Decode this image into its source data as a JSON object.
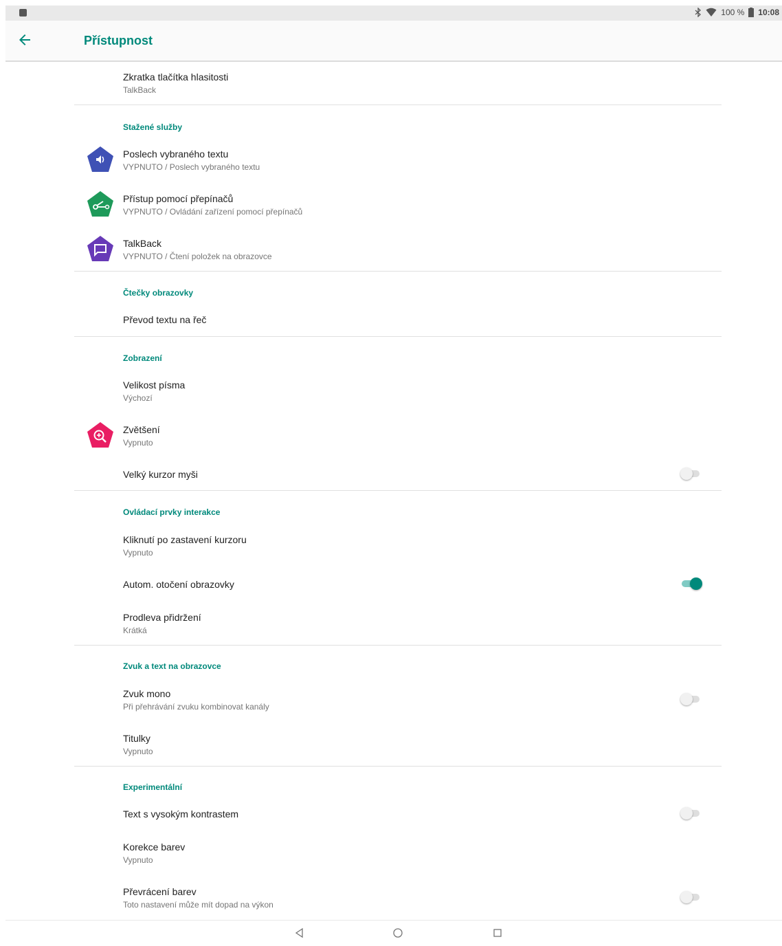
{
  "status_bar": {
    "battery": "100 %",
    "time": "10:08"
  },
  "header": {
    "title": "Přístupnost"
  },
  "items": {
    "volume_shortcut": {
      "title": "Zkratka tlačítka hlasitosti",
      "subtitle": "TalkBack"
    },
    "select_to_speak": {
      "title": "Poslech vybraného textu",
      "subtitle": "VYPNUTO / Poslech vybraného textu"
    },
    "switch_access": {
      "title": "Přístup pomocí přepínačů",
      "subtitle": "VYPNUTO / Ovládání zařízení pomocí přepínačů"
    },
    "talkback": {
      "title": "TalkBack",
      "subtitle": "VYPNUTO / Čtení položek na obrazovce"
    },
    "tts": {
      "title": "Převod textu na řeč"
    },
    "font_size": {
      "title": "Velikost písma",
      "subtitle": "Výchozí"
    },
    "magnification": {
      "title": "Zvětšení",
      "subtitle": "Vypnuto"
    },
    "large_pointer": {
      "title": "Velký kurzor myši",
      "enabled": false
    },
    "dwell_click": {
      "title": "Kliknutí po zastavení kurzoru",
      "subtitle": "Vypnuto"
    },
    "auto_rotate": {
      "title": "Autom. otočení obrazovky",
      "enabled": true
    },
    "touch_delay": {
      "title": "Prodleva přidržení",
      "subtitle": "Krátká"
    },
    "mono_audio": {
      "title": "Zvuk mono",
      "subtitle": "Při přehrávání zvuku kombinovat kanály",
      "enabled": false
    },
    "captions": {
      "title": "Titulky",
      "subtitle": "Vypnuto"
    },
    "high_contrast": {
      "title": "Text s vysokým kontrastem",
      "enabled": false
    },
    "color_correction": {
      "title": "Korekce barev",
      "subtitle": "Vypnuto"
    },
    "color_inversion": {
      "title": "Převrácení barev",
      "subtitle": "Toto nastavení může mít dopad na výkon",
      "enabled": false
    }
  },
  "sections": {
    "downloaded": "Stažené služby",
    "screen_readers": "Čtečky obrazovky",
    "display": "Zobrazení",
    "interaction": "Ovládací prvky interakce",
    "audio": "Zvuk a text na obrazovce",
    "experimental": "Experimentální"
  },
  "colors": {
    "accent": "#00897b",
    "select_to_speak_icon": "#3f51b5",
    "switch_access_icon": "#1e9a5a",
    "talkback_icon": "#673ab7",
    "magnification_icon": "#e91e63"
  },
  "icons": {
    "back": "arrow-left-icon",
    "select_to_speak": "speaker-icon",
    "switch_access": "switch-icon",
    "talkback": "speech-bubble-icon",
    "magnification": "zoom-in-icon"
  }
}
